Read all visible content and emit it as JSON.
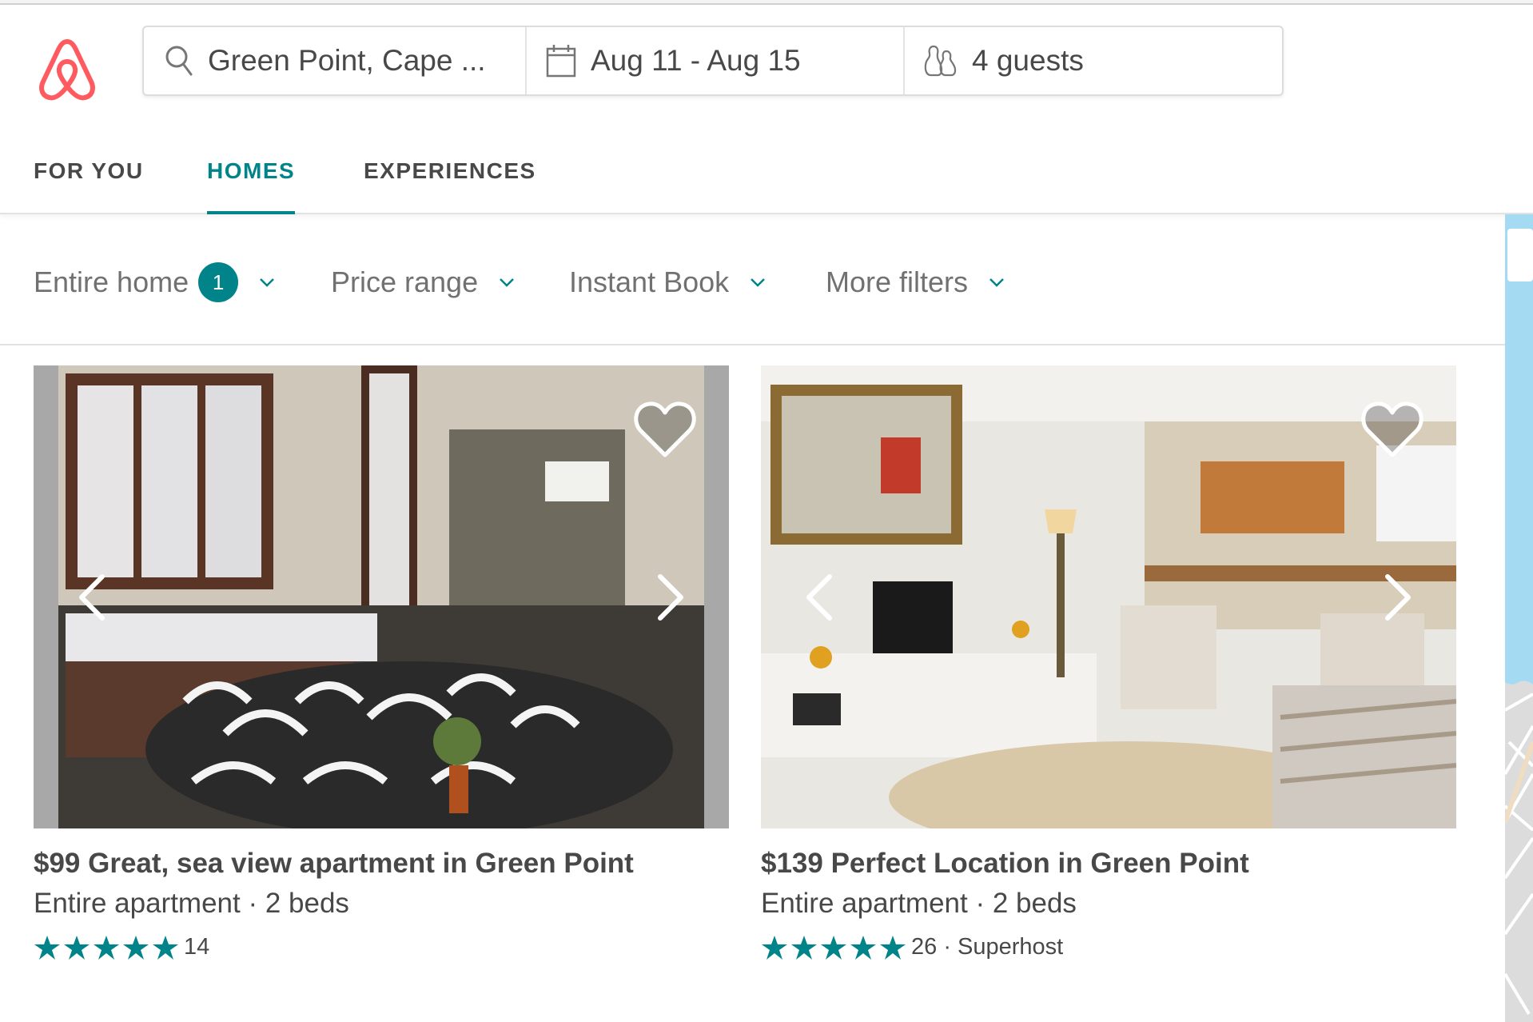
{
  "brand": {
    "logo": "airbnb-logo",
    "color": "#FF5A5F"
  },
  "search": {
    "location_icon": "search-icon",
    "location": "Green Point, Cape ...",
    "dates_icon": "calendar-icon",
    "dates": "Aug 11 - Aug 15",
    "guests_icon": "guests-icon",
    "guests": "4 guests"
  },
  "tabs": [
    {
      "label": "FOR YOU",
      "active": false
    },
    {
      "label": "HOMES",
      "active": true
    },
    {
      "label": "EXPERIENCES",
      "active": false
    }
  ],
  "filters": [
    {
      "label": "Entire home",
      "badge": "1"
    },
    {
      "label": "Price range"
    },
    {
      "label": "Instant Book"
    },
    {
      "label": "More filters"
    }
  ],
  "accent_color": "#008489",
  "listings": [
    {
      "price": "$99",
      "name": "Great, sea view apartment in Green Point",
      "title": "$99 Great, sea view apartment in Green Point",
      "details": "Entire apartment · 2 beds",
      "stars": 5,
      "reviews_text": "14",
      "saved": false
    },
    {
      "price": "$139",
      "name": "Perfect Location in Green Point",
      "title": "$139 Perfect Location in Green Point",
      "details": "Entire apartment · 2 beds",
      "stars": 5,
      "reviews_text": "26 · Superhost",
      "saved": false
    }
  ]
}
